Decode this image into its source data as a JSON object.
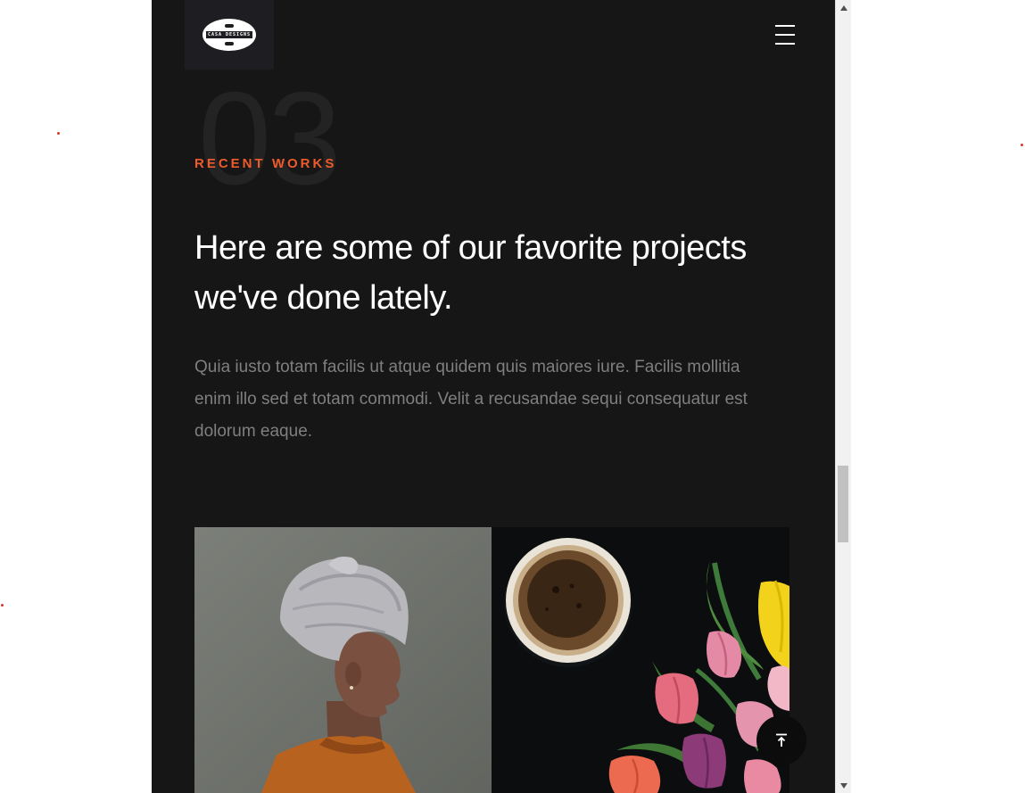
{
  "header": {
    "logo_text": "CASA DESIGNS",
    "menu_icon": "hamburger-menu-icon"
  },
  "section": {
    "number": "03",
    "eyebrow": "RECENT WORKS",
    "headline": "Here are some of our favorite projects we've done lately.",
    "description": "Quia iusto totam facilis ut atque quidem quis maiores iure. Facilis mollitia enim illo sed et totam commodi. Velit a recusandae sequi consequatur est dolorum eaque."
  },
  "gallery": {
    "items": [
      {
        "subject": "portrait-woman-headwrap",
        "bg_color": "#727570"
      },
      {
        "subject": "coffee-and-tulips",
        "bg_color": "#0b0d0e"
      }
    ]
  },
  "back_to_top_icon": "arrow-up-to-line-icon",
  "colors": {
    "page_bg": "#161616",
    "accent": "#ee5a2b",
    "heading": "#ffffff",
    "body_text": "#7f7f7f",
    "big_number": "#232323"
  }
}
